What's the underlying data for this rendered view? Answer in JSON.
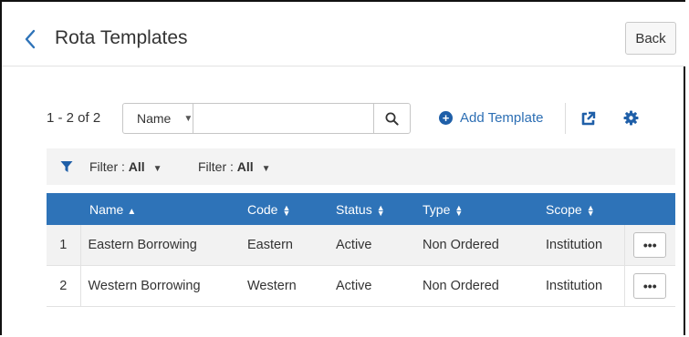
{
  "header": {
    "title": "Rota Templates",
    "back_label": "Back"
  },
  "toolbar": {
    "count": "1 - 2 of 2",
    "search_field": "Name",
    "search_value": "",
    "add_label": "Add Template"
  },
  "filters": [
    {
      "label": "Filter : ",
      "value": "All"
    },
    {
      "label": "Filter : ",
      "value": "All"
    }
  ],
  "table": {
    "columns": [
      "Name",
      "Code",
      "Status",
      "Type",
      "Scope"
    ],
    "rows": [
      {
        "num": "1",
        "name": "Eastern Borrowing",
        "code": "Eastern",
        "status": "Active",
        "type": "Non Ordered",
        "scope": "Institution"
      },
      {
        "num": "2",
        "name": "Western Borrowing",
        "code": "Western",
        "status": "Active",
        "type": "Non Ordered",
        "scope": "Institution"
      }
    ],
    "more_label": "•••"
  },
  "colors": {
    "accent": "#2e73b8",
    "link": "#2d6fb4",
    "filter_bg": "#f3f3f3"
  }
}
